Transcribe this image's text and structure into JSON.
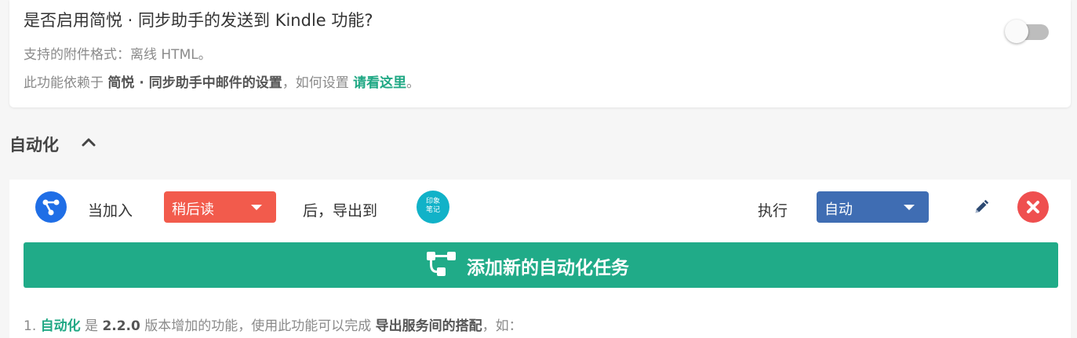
{
  "kindle": {
    "question": "是否启用简悦 · 同步助手的发送到 Kindle 功能?",
    "formats": "支持的附件格式：离线 HTML。",
    "dep_prefix": "此功能依赖于 ",
    "dep_bold": "简悦 · 同步助手中邮件的设置",
    "dep_mid": "，如何设置 ",
    "dep_link": "请看这里",
    "dep_suffix": "。",
    "toggle_on": false
  },
  "automation": {
    "title": "自动化",
    "rule": {
      "when_label": "当加入",
      "trigger_value": "稍后读",
      "then_label": "后，导出到",
      "service_icon_text_1": "印象",
      "service_icon_text_2": "笔记",
      "exec_label": "执行",
      "mode_value": "自动"
    },
    "add_button": "添加新的自动化任务",
    "note": {
      "num": "1. ",
      "term": "自动化",
      "t1": " 是 ",
      "version": "2.2.0",
      "t2": " 版本增加的功能，使用此功能可以完成 ",
      "bold": "导出服务间的搭配",
      "t3": "，如："
    }
  },
  "colors": {
    "accent": "#20ab88",
    "danger": "#ef4f4f",
    "trigger": "#f25b4c",
    "mode": "#3f6db3",
    "evernote": "#11b2c8",
    "flow_icon": "#1f6ee6"
  },
  "icons": [
    "flow-icon",
    "evernote-icon",
    "pencil-icon",
    "close-icon",
    "chevron-up-icon"
  ]
}
